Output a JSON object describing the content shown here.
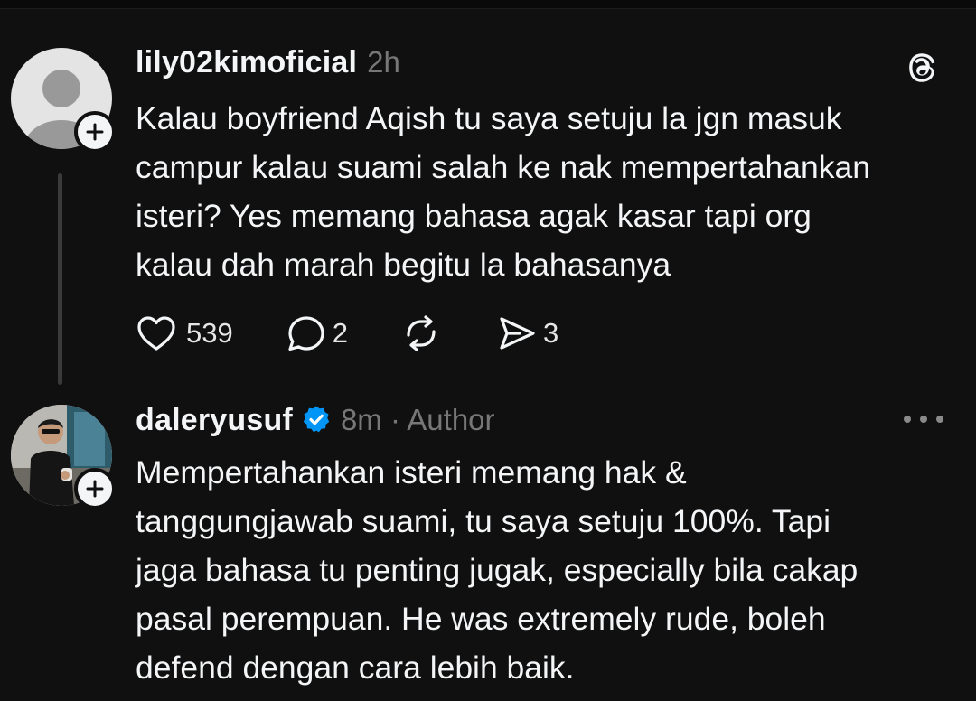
{
  "posts": [
    {
      "username": "lily02kimoficial",
      "time": "2h",
      "text": "Kalau boyfriend Aqish tu saya setuju la jgn masuk\ncampur kalau suami salah ke nak mempertahankan\nisteri? Yes memang bahasa agak kasar tapi org\nkalau dah marah begitu la bahasanya",
      "likes": "539",
      "replies": "2",
      "shares": "3",
      "avatar_icon": "default-person-icon",
      "corner_icon": "threads-logo-icon"
    },
    {
      "username": "daleryusuf",
      "verified": true,
      "time_meta": "8m · Author",
      "text": "Mempertahankan isteri memang hak &\ntanggungjawab suami, tu saya setuju 100%. Tapi\njaga bahasa tu penting jugak, especially bila cakap\npasal perempuan. He was extremely rude, boleh\ndefend dengan cara lebih baik.",
      "avatar_icon": "profile-photo",
      "corner_icon": "more-options-icon"
    }
  ],
  "colors": {
    "background": "#101010",
    "text": "#f3f5f7",
    "muted": "#777777",
    "verified": "#0095f6",
    "thread_line": "#3a3a3a"
  }
}
